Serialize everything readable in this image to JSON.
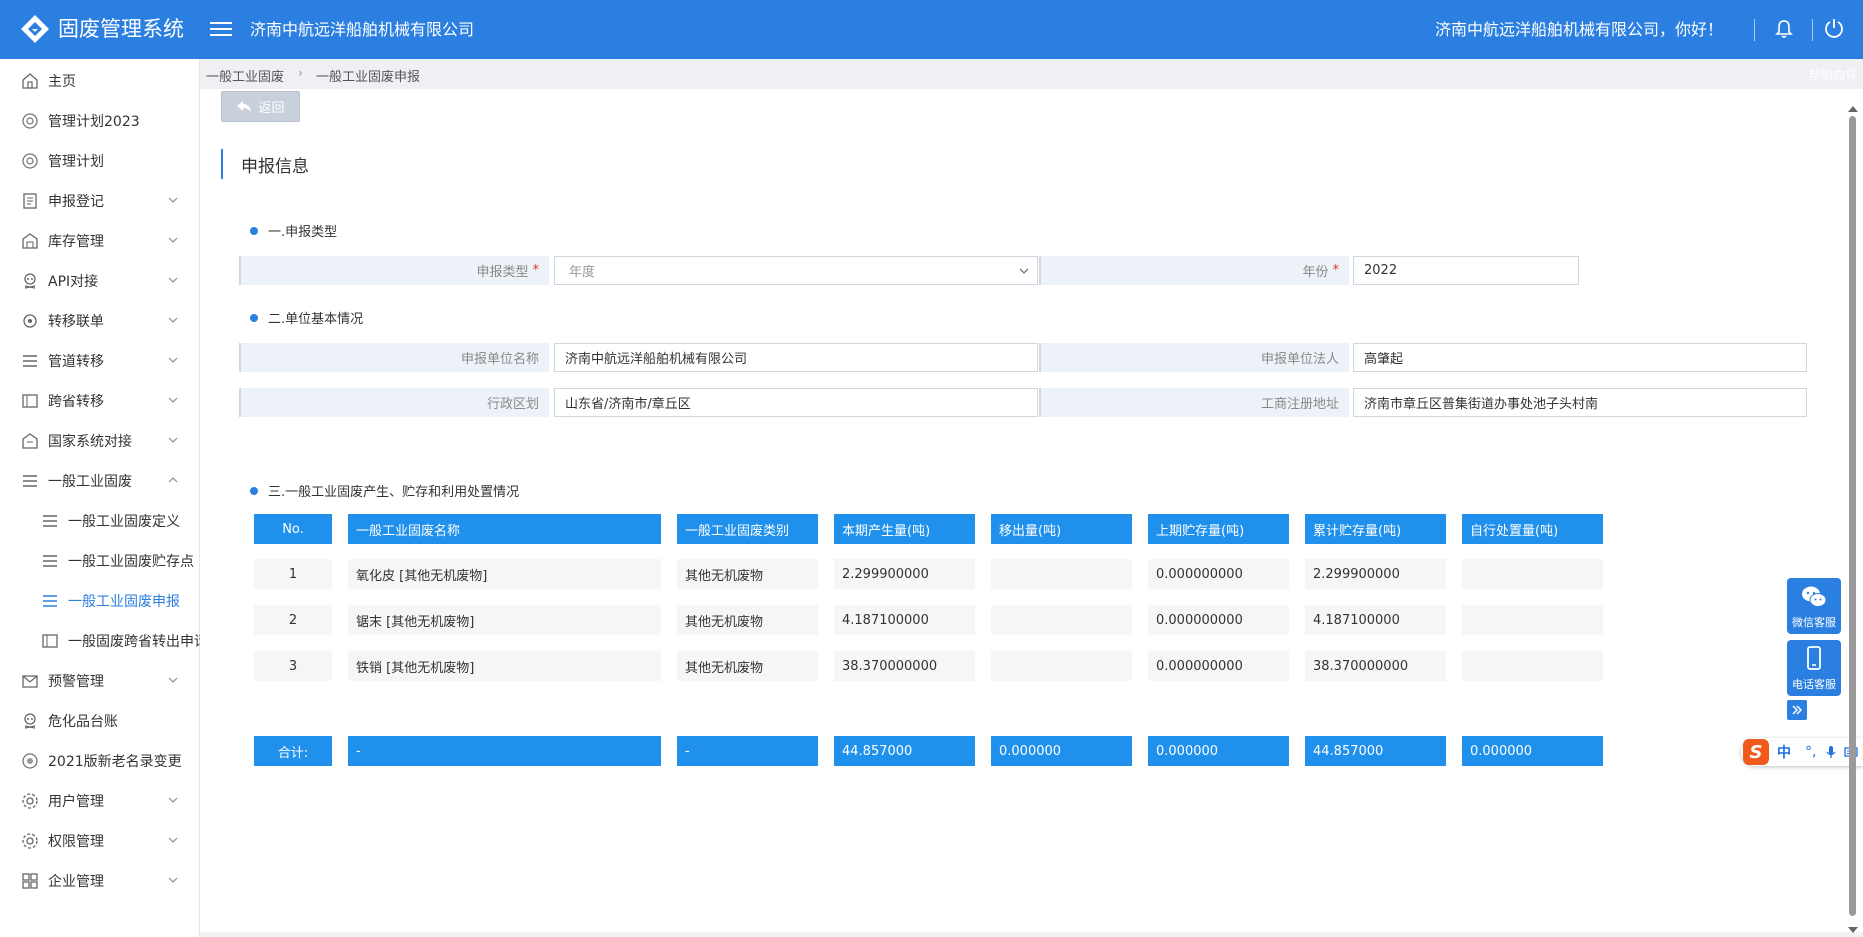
{
  "header": {
    "app_title": "固废管理系统",
    "company": "济南中航远洋船舶机械有限公司",
    "greeting": "济南中航远洋船舶机械有限公司，你好！"
  },
  "sidebar": {
    "items": [
      {
        "label": "主页",
        "icon": "home-icon"
      },
      {
        "label": "管理计划2023",
        "icon": "plan-icon"
      },
      {
        "label": "管理计划",
        "icon": "plan-icon"
      },
      {
        "label": "申报登记",
        "icon": "declare-icon"
      },
      {
        "label": "库存管理",
        "icon": "warehouse-icon"
      },
      {
        "label": "API对接",
        "icon": "api-icon"
      },
      {
        "label": "转移联单",
        "icon": "transfer-icon"
      },
      {
        "label": "管道转移",
        "icon": "list-icon"
      },
      {
        "label": "跨省转移",
        "icon": "cross-province-icon"
      },
      {
        "label": "国家系统对接",
        "icon": "national-icon"
      },
      {
        "label": "一般工业固废",
        "icon": "list-icon"
      },
      {
        "label": "一般工业固废定义",
        "icon": "list-icon"
      },
      {
        "label": "一般工业固废贮存点",
        "icon": "list-icon"
      },
      {
        "label": "一般工业固废申报",
        "icon": "list-icon"
      },
      {
        "label": "一般固废跨省转出申请",
        "icon": "cross-province-icon"
      },
      {
        "label": "预警管理",
        "icon": "mail-icon"
      },
      {
        "label": "危化品台账",
        "icon": "hazard-icon"
      },
      {
        "label": "2021版新老名录变更",
        "icon": "catalog-icon"
      },
      {
        "label": "用户管理",
        "icon": "gear-icon"
      },
      {
        "label": "权限管理",
        "icon": "gear-icon"
      },
      {
        "label": "企业管理",
        "icon": "grid-icon"
      }
    ]
  },
  "breadcrumb": {
    "level1": "一般工业固废",
    "level2": "一般工业固废申报",
    "help": "帮助向导"
  },
  "main": {
    "back_label": "返回",
    "section_title": "申报信息",
    "sec1_title": "一.申报类型",
    "sec2_title": "二.单位基本情况",
    "sec3_title": "三.一般工业固废产生、贮存和利用处置情况",
    "form": {
      "report_type_label": "申报类型",
      "report_type_value": "年度",
      "year_label": "年份",
      "year_value": "2022",
      "unit_name_label": "申报单位名称",
      "unit_name_value": "济南中航远洋船舶机械有限公司",
      "legal_person_label": "申报单位法人",
      "legal_person_value": "高肇起",
      "region_label": "行政区划",
      "region_value": "山东省/济南市/章丘区",
      "address_label": "工商注册地址",
      "address_value": "济南市章丘区普集街道办事处池子头村南"
    },
    "table": {
      "headers": [
        "No.",
        "一般工业固废名称",
        "一般工业固废类别",
        "本期产生量(吨)",
        "移出量(吨)",
        "上期贮存量(吨)",
        "累计贮存量(吨)",
        "自行处置量(吨)"
      ],
      "rows": [
        [
          "1",
          "氧化皮 [其他无机废物]",
          "其他无机废物",
          "2.299900000",
          "",
          "0.000000000",
          "2.299900000",
          ""
        ],
        [
          "2",
          "锯末 [其他无机废物]",
          "其他无机废物",
          "4.187100000",
          "",
          "0.000000000",
          "4.187100000",
          ""
        ],
        [
          "3",
          "铁销 [其他无机废物]",
          "其他无机废物",
          "38.370000000",
          "",
          "0.000000000",
          "38.370000000",
          ""
        ]
      ],
      "footer": [
        "合计:",
        "-",
        "-",
        "44.857000",
        "0.000000",
        "0.000000",
        "44.857000",
        "0.000000"
      ]
    }
  },
  "float": {
    "wechat_label": "微信客服",
    "phone_label": "电话客服"
  },
  "ime": {
    "logo": "S",
    "mode": "中",
    "punct": "°,"
  },
  "colors": {
    "primary": "#2b7fe0",
    "table_header": "#1f90eb",
    "required": "#e03030"
  }
}
